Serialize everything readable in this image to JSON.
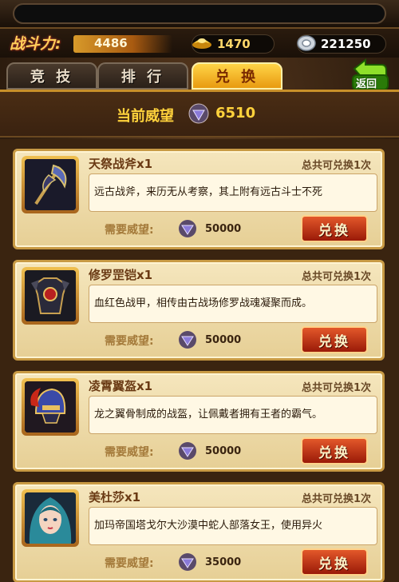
{
  "stats": {
    "power_label": "战斗力:",
    "power_value": "4486",
    "gold_value": "1470",
    "silver_value": "221250"
  },
  "tabs": [
    {
      "label": "竞 技",
      "active": false
    },
    {
      "label": "排 行",
      "active": false
    },
    {
      "label": "兑 换",
      "active": true
    }
  ],
  "back_label": "返回",
  "prestige": {
    "label": "当前威望",
    "value": "6510"
  },
  "cost_label": "需要威望:",
  "exchange_label": "兑换",
  "items": [
    {
      "name": "天祭战斧x1",
      "limit": "总共可兑换1次",
      "desc": "远古战斧，来历无从考察，其上附有远古斗士不死",
      "cost": "50000",
      "icon": "battle-axe"
    },
    {
      "name": "修罗罡铠x1",
      "limit": "总共可兑换1次",
      "desc": "血红色战甲，相传由古战场修罗战魂凝聚而成。",
      "cost": "50000",
      "icon": "armor"
    },
    {
      "name": "凌霄翼盔x1",
      "limit": "总共可兑换1次",
      "desc": "龙之翼骨制成的战盔，让佩戴者拥有王者的霸气。",
      "cost": "50000",
      "icon": "helmet"
    },
    {
      "name": "美杜莎x1",
      "limit": "总共可兑换1次",
      "desc": "加玛帝国塔戈尔大沙漠中蛇人部落女王，使用异火",
      "cost": "35000",
      "icon": "medusa-portrait"
    }
  ],
  "colors": {
    "gold_text": "#ffd23c",
    "active_tab": "#ffd447",
    "exchange_button": "#c8381a",
    "card_bg": "#f5e6bd"
  }
}
